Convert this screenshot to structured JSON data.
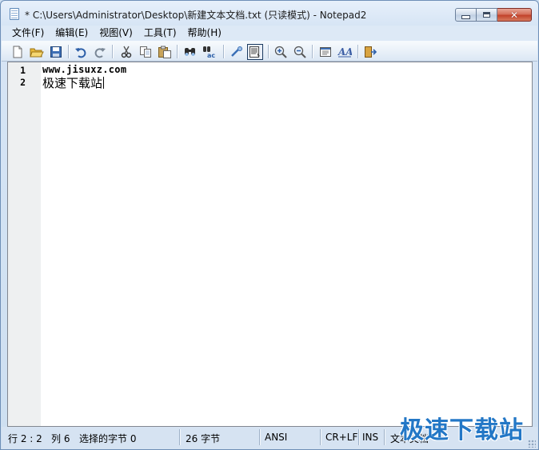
{
  "window": {
    "title": "* C:\\Users\\Administrator\\Desktop\\新建文本文档.txt (只读模式) - Notepad2",
    "buttons": {
      "minimize": "minimize",
      "maximize": "maximize",
      "close": "close"
    }
  },
  "menu": {
    "items": [
      "文件(F)",
      "编辑(E)",
      "视图(V)",
      "工具(T)",
      "帮助(H)"
    ]
  },
  "toolbar": {
    "buttons": [
      "new-icon",
      "open-icon",
      "save-icon",
      "undo-icon",
      "redo-icon",
      "cut-icon",
      "copy-icon",
      "paste-icon",
      "find-icon",
      "replace-icon",
      "word-wrap-icon",
      "read-only-icon",
      "zoom-in-icon",
      "zoom-out-icon",
      "scheme-icon",
      "font-icon",
      "exit-icon"
    ],
    "pressed": "read-only-icon"
  },
  "editor": {
    "lines": [
      {
        "number": "1",
        "text": "www.jisuxz.com"
      },
      {
        "number": "2",
        "text": "极速下载站"
      }
    ]
  },
  "status": {
    "position": "行 2 : 2",
    "column": "列 6",
    "selection": "选择的字节 0",
    "bytes": "26 字节",
    "encoding": "ANSI",
    "line_ending": "CR+LF",
    "mode": "INS",
    "doc_type": "文本文档"
  },
  "watermark": "极速下载站",
  "colors": {
    "frame": "#cddff1",
    "gutter": "#eef0f1",
    "watermark": "#2377c6"
  }
}
